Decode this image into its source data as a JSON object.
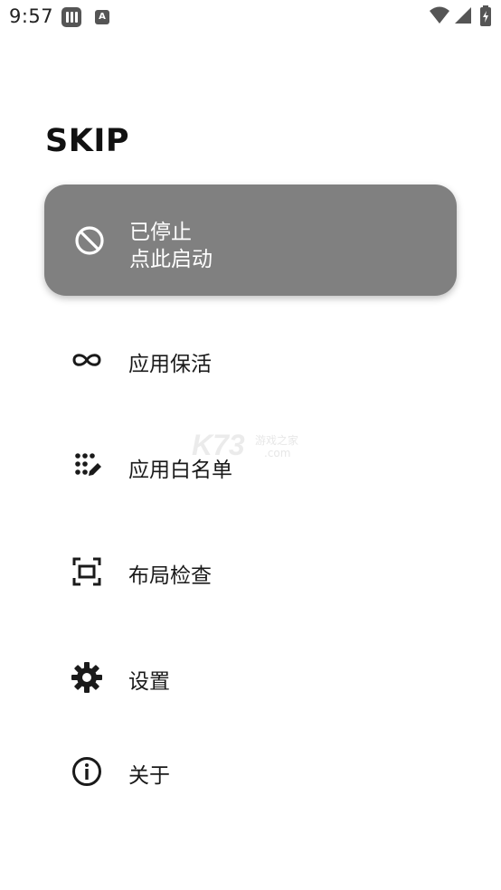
{
  "status_bar": {
    "time": "9:57",
    "app_icon_2_letter": "A",
    "icons": [
      "app-notification-icon",
      "app-notification-icon",
      "wifi-icon",
      "cell-signal-icon",
      "battery-icon"
    ]
  },
  "app": {
    "title": "SKIP"
  },
  "status_card": {
    "line1": "已停止",
    "line2": "点此启动",
    "icon": "block-icon",
    "background": "#808080"
  },
  "menu": [
    {
      "label": "应用保活",
      "icon": "infinity-icon"
    },
    {
      "label": "应用白名单",
      "icon": "dots-pencil-icon"
    },
    {
      "label": "布局检查",
      "icon": "frame-scan-icon"
    },
    {
      "label": "设置",
      "icon": "gear-icon"
    },
    {
      "label": "关于",
      "icon": "info-icon"
    }
  ],
  "watermark": {
    "logo": "K73",
    "tagline": "游戏之家",
    "domain": ".com"
  }
}
